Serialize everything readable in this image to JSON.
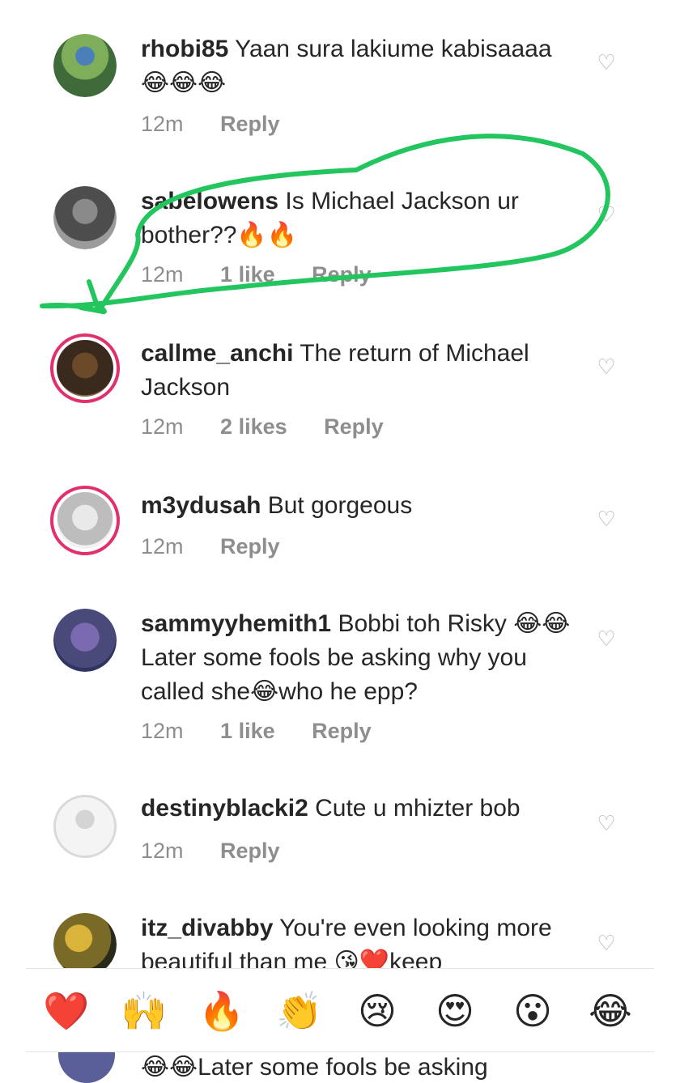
{
  "comments": [
    {
      "user": "rhobi85",
      "text": "Yaan sura lakiume kabisaaaa😂😂😂",
      "time": "12m",
      "likes": "",
      "reply": "Reply"
    },
    {
      "user": "sabelowens",
      "text": "Is Michael Jackson ur bother??🔥🔥",
      "time": "12m",
      "likes": "1 like",
      "reply": "Reply"
    },
    {
      "user": "callme_anchi",
      "text": "The return of Michael Jackson",
      "time": "12m",
      "likes": "2 likes",
      "reply": "Reply"
    },
    {
      "user": "m3ydusah",
      "text": "But gorgeous",
      "time": "12m",
      "likes": "",
      "reply": "Reply"
    },
    {
      "user": "sammyyhemith1",
      "text": "Bobbi toh Risky 😂😂Later some fools be asking why you called she😂who he epp?",
      "time": "12m",
      "likes": "1 like",
      "reply": "Reply"
    },
    {
      "user": "destinyblacki2",
      "text": "Cute u mhizter bob",
      "time": "12m",
      "likes": "",
      "reply": "Reply"
    },
    {
      "user": "itz_divabby",
      "text": "You're even looking more beautiful than me 😘❤️keep",
      "time": "",
      "likes": "",
      "reply": ""
    }
  ],
  "reactions": [
    "❤️",
    "🙌",
    "🔥",
    "👏",
    "😢",
    "😍",
    "😮",
    "😂"
  ],
  "under_text": "😂😂Later some fools be asking",
  "colors": {
    "highlight": "#22c55e",
    "story_ring": "#d6249f",
    "meta": "#8e8e8e"
  }
}
